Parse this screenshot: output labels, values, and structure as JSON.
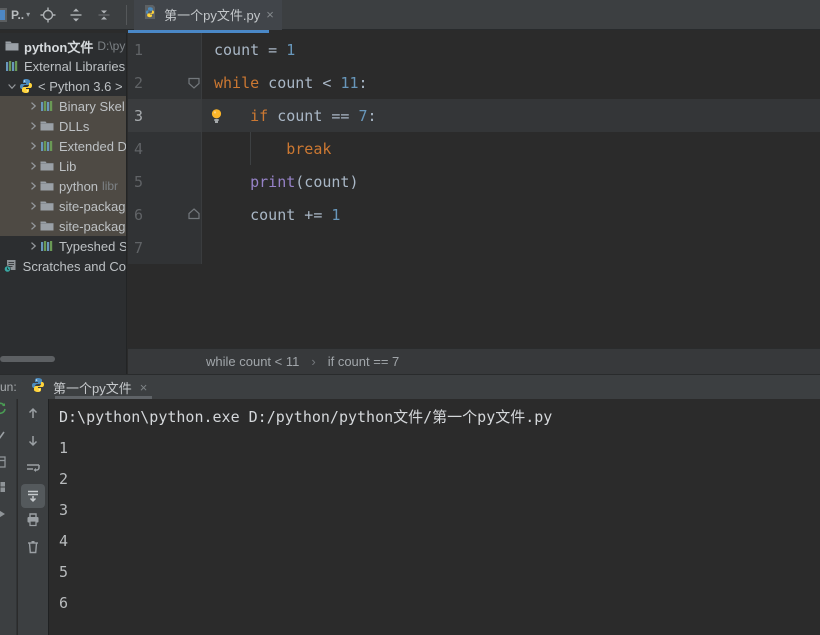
{
  "accent_colors": {
    "tab_underline": "#4a88c7",
    "keyword": "#cc7832",
    "number": "#6897bb",
    "builtin": "#9682c7",
    "bulb": "#fbb529"
  },
  "header": {
    "project_label": "P..",
    "caret": "▾",
    "icons": [
      "locate-icon",
      "expand-all-icon",
      "collapse-all-icon"
    ]
  },
  "editor_tab": {
    "title": "第一个py文件.py",
    "close": "×",
    "icon": "python-file-icon"
  },
  "project_tree": {
    "items": [
      {
        "label": "python文件",
        "suffix": "D:\\py",
        "icon": "folder",
        "chevron": "none",
        "level": 0,
        "bold": true,
        "hl": false
      },
      {
        "label": "External Libraries",
        "suffix": "",
        "icon": "library",
        "chevron": "none",
        "level": 0,
        "bold": false,
        "hl": false
      },
      {
        "label": "< Python 3.6 >",
        "suffix": "",
        "icon": "python",
        "chevron": "expanded",
        "level": 0,
        "bold": false,
        "hl": false
      },
      {
        "label": "Binary Skel",
        "suffix": "",
        "icon": "library",
        "chevron": "collapsed",
        "level": 1,
        "bold": false,
        "hl": true
      },
      {
        "label": "DLLs",
        "suffix": "",
        "icon": "folder",
        "chevron": "collapsed",
        "level": 1,
        "bold": false,
        "hl": true
      },
      {
        "label": "Extended D",
        "suffix": "",
        "icon": "library",
        "chevron": "collapsed",
        "level": 1,
        "bold": false,
        "hl": true
      },
      {
        "label": "Lib",
        "suffix": "",
        "icon": "folder",
        "chevron": "collapsed",
        "level": 1,
        "bold": false,
        "hl": true
      },
      {
        "label": "python",
        "suffix": "libr",
        "icon": "folder",
        "chevron": "collapsed",
        "level": 1,
        "bold": false,
        "hl": true
      },
      {
        "label": "site-packag",
        "suffix": "",
        "icon": "folder",
        "chevron": "collapsed",
        "level": 1,
        "bold": false,
        "hl": true
      },
      {
        "label": "site-packag",
        "suffix": "",
        "icon": "folder",
        "chevron": "collapsed",
        "level": 1,
        "bold": false,
        "hl": true
      },
      {
        "label": "Typeshed S",
        "suffix": "",
        "icon": "library",
        "chevron": "collapsed",
        "level": 1,
        "bold": false,
        "hl": false
      },
      {
        "label": "Scratches and Co",
        "suffix": "",
        "icon": "scratches",
        "chevron": "none",
        "level": 0,
        "bold": false,
        "hl": false
      }
    ]
  },
  "editor": {
    "lines": [
      {
        "num": "1",
        "tokens": [
          {
            "t": "count = ",
            "c": "def"
          },
          {
            "t": "1",
            "c": "num"
          }
        ],
        "fold": "none",
        "bulb": false,
        "current": false,
        "guide": false
      },
      {
        "num": "2",
        "tokens": [
          {
            "t": "while",
            "c": "kw"
          },
          {
            "t": " count < ",
            "c": "def"
          },
          {
            "t": "11",
            "c": "num"
          },
          {
            "t": ":",
            "c": "def"
          }
        ],
        "fold": "down",
        "bulb": false,
        "current": false,
        "guide": false
      },
      {
        "num": "3",
        "tokens": [
          {
            "t": "    ",
            "c": "def"
          },
          {
            "t": "if",
            "c": "kw"
          },
          {
            "t": " count == ",
            "c": "def"
          },
          {
            "t": "7",
            "c": "num"
          },
          {
            "t": ":",
            "c": "def"
          }
        ],
        "fold": "none",
        "bulb": true,
        "current": true,
        "guide": false
      },
      {
        "num": "4",
        "tokens": [
          {
            "t": "        ",
            "c": "def"
          },
          {
            "t": "break",
            "c": "kw"
          }
        ],
        "fold": "none",
        "bulb": false,
        "current": false,
        "guide": true
      },
      {
        "num": "5",
        "tokens": [
          {
            "t": "    ",
            "c": "def"
          },
          {
            "t": "print",
            "c": "builtin"
          },
          {
            "t": "(count)",
            "c": "def"
          }
        ],
        "fold": "none",
        "bulb": false,
        "current": false,
        "guide": false
      },
      {
        "num": "6",
        "tokens": [
          {
            "t": "    ",
            "c": "def"
          },
          {
            "t": "count += ",
            "c": "def"
          },
          {
            "t": "1",
            "c": "num"
          }
        ],
        "fold": "up",
        "bulb": false,
        "current": false,
        "guide": false
      },
      {
        "num": "7",
        "tokens": [],
        "fold": "none",
        "bulb": false,
        "current": false,
        "guide": false
      }
    ],
    "breadcrumbs": [
      "while count < 11",
      "if count == 7"
    ],
    "breadcrumb_separator": "›"
  },
  "run_panel": {
    "label": "un:",
    "tab": {
      "title": "第一个py文件",
      "close": "×",
      "icon": "python-icon"
    },
    "toolbar_icons": [
      "scroll-up-icon",
      "scroll-down-icon",
      "soft-wrap-icon",
      "scroll-to-end-icon",
      "print-icon",
      "clear-icon"
    ],
    "active_toolbar_icon": "scroll-to-end-icon",
    "console_lines": [
      {
        "text": "D:\\python\\python.exe D:/python/python文件/第一个py文件.py",
        "kind": "command"
      },
      {
        "text": "1",
        "kind": "output"
      },
      {
        "text": "2",
        "kind": "output"
      },
      {
        "text": "3",
        "kind": "output"
      },
      {
        "text": "4",
        "kind": "output"
      },
      {
        "text": "5",
        "kind": "output"
      },
      {
        "text": "6",
        "kind": "output"
      }
    ]
  }
}
